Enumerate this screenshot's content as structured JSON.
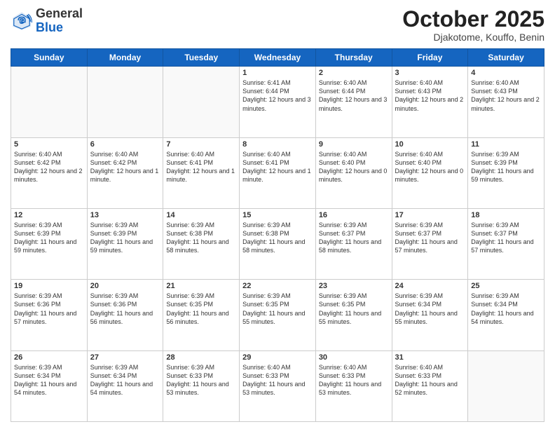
{
  "logo": {
    "general": "General",
    "blue": "Blue"
  },
  "header": {
    "month": "October 2025",
    "location": "Djakotome, Kouffo, Benin"
  },
  "weekdays": [
    "Sunday",
    "Monday",
    "Tuesday",
    "Wednesday",
    "Thursday",
    "Friday",
    "Saturday"
  ],
  "weeks": [
    [
      {
        "day": "",
        "info": ""
      },
      {
        "day": "",
        "info": ""
      },
      {
        "day": "",
        "info": ""
      },
      {
        "day": "1",
        "info": "Sunrise: 6:41 AM\nSunset: 6:44 PM\nDaylight: 12 hours\nand 3 minutes."
      },
      {
        "day": "2",
        "info": "Sunrise: 6:40 AM\nSunset: 6:44 PM\nDaylight: 12 hours\nand 3 minutes."
      },
      {
        "day": "3",
        "info": "Sunrise: 6:40 AM\nSunset: 6:43 PM\nDaylight: 12 hours\nand 2 minutes."
      },
      {
        "day": "4",
        "info": "Sunrise: 6:40 AM\nSunset: 6:43 PM\nDaylight: 12 hours\nand 2 minutes."
      }
    ],
    [
      {
        "day": "5",
        "info": "Sunrise: 6:40 AM\nSunset: 6:42 PM\nDaylight: 12 hours\nand 2 minutes."
      },
      {
        "day": "6",
        "info": "Sunrise: 6:40 AM\nSunset: 6:42 PM\nDaylight: 12 hours\nand 1 minute."
      },
      {
        "day": "7",
        "info": "Sunrise: 6:40 AM\nSunset: 6:41 PM\nDaylight: 12 hours\nand 1 minute."
      },
      {
        "day": "8",
        "info": "Sunrise: 6:40 AM\nSunset: 6:41 PM\nDaylight: 12 hours\nand 1 minute."
      },
      {
        "day": "9",
        "info": "Sunrise: 6:40 AM\nSunset: 6:40 PM\nDaylight: 12 hours\nand 0 minutes."
      },
      {
        "day": "10",
        "info": "Sunrise: 6:40 AM\nSunset: 6:40 PM\nDaylight: 12 hours\nand 0 minutes."
      },
      {
        "day": "11",
        "info": "Sunrise: 6:39 AM\nSunset: 6:39 PM\nDaylight: 11 hours\nand 59 minutes."
      }
    ],
    [
      {
        "day": "12",
        "info": "Sunrise: 6:39 AM\nSunset: 6:39 PM\nDaylight: 11 hours\nand 59 minutes."
      },
      {
        "day": "13",
        "info": "Sunrise: 6:39 AM\nSunset: 6:39 PM\nDaylight: 11 hours\nand 59 minutes."
      },
      {
        "day": "14",
        "info": "Sunrise: 6:39 AM\nSunset: 6:38 PM\nDaylight: 11 hours\nand 58 minutes."
      },
      {
        "day": "15",
        "info": "Sunrise: 6:39 AM\nSunset: 6:38 PM\nDaylight: 11 hours\nand 58 minutes."
      },
      {
        "day": "16",
        "info": "Sunrise: 6:39 AM\nSunset: 6:37 PM\nDaylight: 11 hours\nand 58 minutes."
      },
      {
        "day": "17",
        "info": "Sunrise: 6:39 AM\nSunset: 6:37 PM\nDaylight: 11 hours\nand 57 minutes."
      },
      {
        "day": "18",
        "info": "Sunrise: 6:39 AM\nSunset: 6:37 PM\nDaylight: 11 hours\nand 57 minutes."
      }
    ],
    [
      {
        "day": "19",
        "info": "Sunrise: 6:39 AM\nSunset: 6:36 PM\nDaylight: 11 hours\nand 57 minutes."
      },
      {
        "day": "20",
        "info": "Sunrise: 6:39 AM\nSunset: 6:36 PM\nDaylight: 11 hours\nand 56 minutes."
      },
      {
        "day": "21",
        "info": "Sunrise: 6:39 AM\nSunset: 6:35 PM\nDaylight: 11 hours\nand 56 minutes."
      },
      {
        "day": "22",
        "info": "Sunrise: 6:39 AM\nSunset: 6:35 PM\nDaylight: 11 hours\nand 55 minutes."
      },
      {
        "day": "23",
        "info": "Sunrise: 6:39 AM\nSunset: 6:35 PM\nDaylight: 11 hours\nand 55 minutes."
      },
      {
        "day": "24",
        "info": "Sunrise: 6:39 AM\nSunset: 6:34 PM\nDaylight: 11 hours\nand 55 minutes."
      },
      {
        "day": "25",
        "info": "Sunrise: 6:39 AM\nSunset: 6:34 PM\nDaylight: 11 hours\nand 54 minutes."
      }
    ],
    [
      {
        "day": "26",
        "info": "Sunrise: 6:39 AM\nSunset: 6:34 PM\nDaylight: 11 hours\nand 54 minutes."
      },
      {
        "day": "27",
        "info": "Sunrise: 6:39 AM\nSunset: 6:34 PM\nDaylight: 11 hours\nand 54 minutes."
      },
      {
        "day": "28",
        "info": "Sunrise: 6:39 AM\nSunset: 6:33 PM\nDaylight: 11 hours\nand 53 minutes."
      },
      {
        "day": "29",
        "info": "Sunrise: 6:40 AM\nSunset: 6:33 PM\nDaylight: 11 hours\nand 53 minutes."
      },
      {
        "day": "30",
        "info": "Sunrise: 6:40 AM\nSunset: 6:33 PM\nDaylight: 11 hours\nand 53 minutes."
      },
      {
        "day": "31",
        "info": "Sunrise: 6:40 AM\nSunset: 6:33 PM\nDaylight: 11 hours\nand 52 minutes."
      },
      {
        "day": "",
        "info": ""
      }
    ]
  ]
}
